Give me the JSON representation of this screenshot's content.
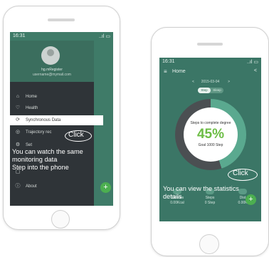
{
  "left_phone": {
    "status_time": "16:31",
    "status_icons": "..ıl ▭",
    "user_name": "hg.mRegister",
    "user_email": "username@mymail.com",
    "menu": [
      {
        "label": "Home",
        "icon": "home-icon",
        "glyph": "⌂"
      },
      {
        "label": "Health",
        "icon": "heart-icon",
        "glyph": "♡"
      },
      {
        "label": "Synchronous Data",
        "icon": "sync-icon",
        "glyph": "⟳"
      },
      {
        "label": "Trajectory rec",
        "icon": "trajectory-icon",
        "glyph": "◎"
      },
      {
        "label": "Set",
        "icon": "settings-icon",
        "glyph": "⚙"
      },
      {
        "label": "",
        "icon": "blank-icon",
        "glyph": "▢"
      },
      {
        "label": "About",
        "icon": "info-icon",
        "glyph": "ⓘ"
      }
    ],
    "fab_glyph": "+",
    "click_label": "Click",
    "annotation": [
      "You can watch the same",
      "monitoring data",
      "Step into the phone"
    ]
  },
  "right_phone": {
    "status_time": "16:31",
    "status_icons": "..ıl ▭",
    "back_glyph": "≡",
    "title": "Home",
    "share_glyph": "<",
    "date": "2015-03-04",
    "prev_glyph": "<",
    "next_glyph": ">",
    "toggle": [
      "Step",
      "Sleep"
    ],
    "ring_caption": "Steps to complete degree",
    "ring_value": "45%",
    "ring_goal": "Goal 1000 Step",
    "ring_progress": 0.45,
    "stats": [
      {
        "label": "Calories",
        "value": "0.00Kcal"
      },
      {
        "label": "Steps",
        "value": "0 Step"
      },
      {
        "label": "Dist",
        "value": "0.00K"
      }
    ],
    "fab_glyph": "+",
    "click_label": "Click",
    "annotation": [
      "You can view the statistics",
      "details"
    ]
  },
  "colors": {
    "accent_green": "#6cbd45",
    "app_green": "#3b7666",
    "drawer_dark": "#2f3438"
  }
}
